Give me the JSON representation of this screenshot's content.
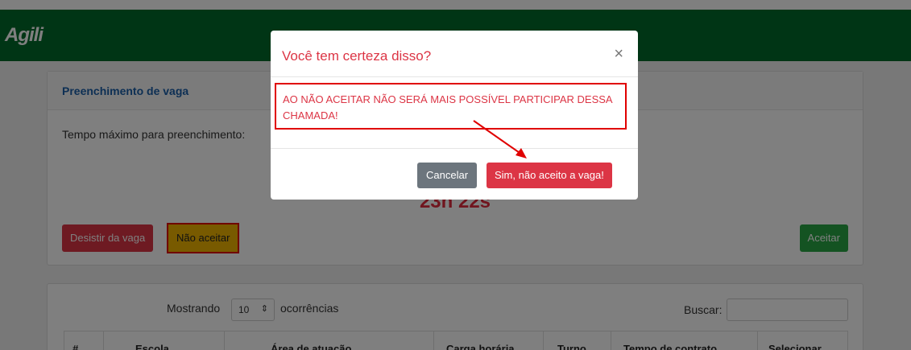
{
  "header": {
    "logo_text": "Agili",
    "bg_color": "#006b2a"
  },
  "vaga_card": {
    "title": "Preenchimento de vaga",
    "tempo_label": "Tempo máximo para preenchimento:",
    "timer_partial": "23h 22s",
    "desistir_label": "Desistir da vaga",
    "nao_aceitar_label": "Não aceitar",
    "aceitar_label": "Aceitar"
  },
  "table_card": {
    "mostrando_label": "Mostrando",
    "page_size": "10",
    "ocorrencias_label": "ocorrências",
    "buscar_label": "Buscar:",
    "columns": [
      "#",
      "Escola",
      "Área de atuação",
      "Carga horária",
      "Turno",
      "Tempo de contrato",
      "Selecionar"
    ]
  },
  "modal": {
    "title": "Você tem certeza disso?",
    "close_symbol": "×",
    "warning_text": "AO NÃO ACEITAR NÃO SERÁ MAIS POSSÍVEL PARTICIPAR DESSA CHAMADA!",
    "cancel_label": "Cancelar",
    "confirm_label": "Sim, não aceito a vaga!"
  },
  "colors": {
    "danger": "#dc3545",
    "highlight_border": "#e00000",
    "success": "#28a745",
    "secondary": "#6c757d",
    "warning": "#f0b400"
  }
}
